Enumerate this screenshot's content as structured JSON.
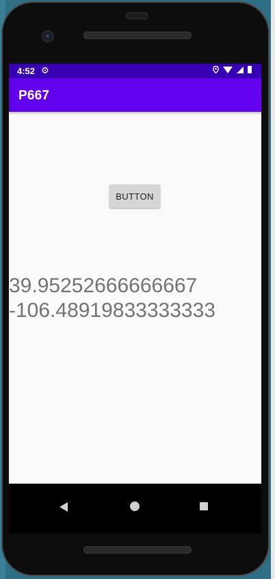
{
  "status_bar": {
    "time": "4:52",
    "icons": [
      "gear-icon",
      "location-icon",
      "wifi-icon",
      "signal-icon",
      "battery-icon"
    ]
  },
  "app_bar": {
    "title": "P667",
    "color": "#6200ee"
  },
  "main": {
    "button_label": "BUTTON",
    "latitude": "39.95252666666667",
    "longitude": "-106.48919833333333"
  },
  "nav_bar": {
    "icons": [
      "back-icon",
      "home-icon",
      "recents-icon"
    ]
  },
  "colors": {
    "status_bar": "#3700b3",
    "primary": "#6200ee",
    "background": "#fafafa",
    "text": "#737373"
  }
}
